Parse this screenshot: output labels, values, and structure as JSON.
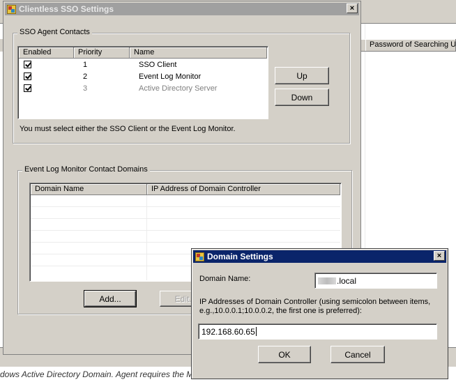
{
  "background": {
    "column_header": "Password of Searching Us",
    "footer_text": "dows Active Directory Domain. Agent requires the M"
  },
  "main_dialog": {
    "title": "Clientless SSO Settings",
    "close_label": "×",
    "sso_group": {
      "legend": "SSO Agent Contacts",
      "columns": [
        "Enabled",
        "Priority",
        "Name"
      ],
      "rows": [
        {
          "enabled": true,
          "priority": "1",
          "name": "SSO Client",
          "disabled": false
        },
        {
          "enabled": true,
          "priority": "2",
          "name": "Event Log Monitor",
          "disabled": false
        },
        {
          "enabled": true,
          "priority": "3",
          "name": "Active Directory Server",
          "disabled": true
        }
      ],
      "up_label": "Up",
      "down_label": "Down",
      "note": "You must select either the SSO Client or the Event Log Monitor."
    },
    "domains_group": {
      "legend": "Event Log Monitor Contact Domains",
      "columns": [
        "Domain Name",
        "IP Address of Domain Controller"
      ],
      "add_label": "Add...",
      "edit_label": "Edit..."
    }
  },
  "domain_dialog": {
    "title": "Domain Settings",
    "close_label": "×",
    "domain_name_label": "Domain Name:",
    "domain_name_value": ".local",
    "ip_label": "IP Addresses of Domain Controller (using semicolon between items, e.g.,10.0.0.1;10.0.0.2, the first one is preferred):",
    "ip_value": "192.168.60.65",
    "ok_label": "OK",
    "cancel_label": "Cancel"
  },
  "colors": {
    "dialog_face": "#d4d0c8",
    "active_title": "#0a246a",
    "inactive_title": "#a0a0a0",
    "disabled_text": "#808080"
  },
  "icons": [
    "app-icon",
    "close-icon",
    "checkbox-checked-icon"
  ]
}
